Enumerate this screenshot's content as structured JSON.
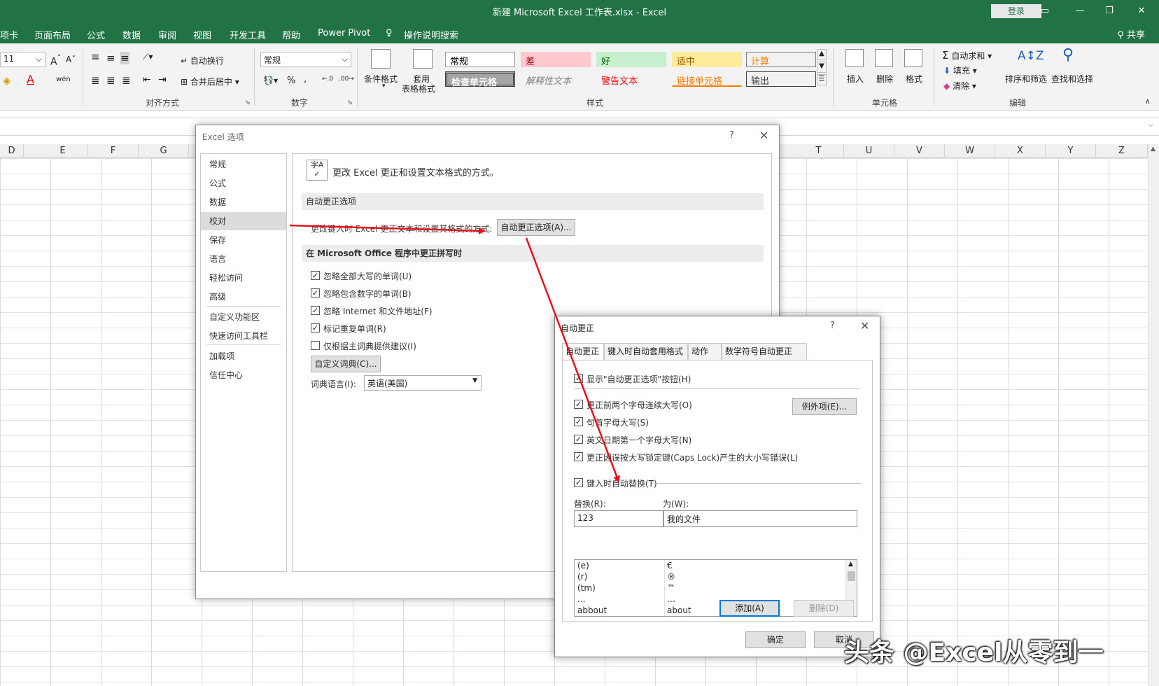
{
  "window": {
    "title": "新建 Microsoft Excel 工作表.xlsx  -  Excel",
    "login": "登录"
  },
  "menu": {
    "tabs": [
      "项卡",
      "页面布局",
      "公式",
      "数据",
      "审阅",
      "视图",
      "开发工具",
      "帮助",
      "Power Pivot",
      "操作说明搜索"
    ],
    "share": "共享"
  },
  "ribbon": {
    "font_size": "11",
    "wrap_text": "自动换行",
    "merge_center": "合并后居中",
    "align_group": "对齐方式",
    "number_format": "常规",
    "number_group": "数字",
    "cond_format": "条件格式",
    "table_format_1": "套用",
    "table_format_2": "表格格式",
    "styles": [
      {
        "label": "常规",
        "bg": "#ffffff",
        "color": "#000000",
        "border": "#9a9a9a"
      },
      {
        "label": "差",
        "bg": "#ffc7ce",
        "color": "#9c0006",
        "border": "#ffc7ce"
      },
      {
        "label": "好",
        "bg": "#c6efce",
        "color": "#006100",
        "border": "#c6efce"
      },
      {
        "label": "适中",
        "bg": "#ffeb9c",
        "color": "#9c5700",
        "border": "#ffeb9c"
      },
      {
        "label": "计算",
        "bg": "#f2f2f2",
        "color": "#fa7d00",
        "border": "#7f7f7f"
      },
      {
        "label": "检查单元格",
        "bg": "#a5a5a5",
        "color": "#ffffff",
        "border": "#3f3f3f"
      },
      {
        "label": "解释性文本",
        "bg": "#f3f3f3",
        "color": "#7f7f7f",
        "border": "#f3f3f3"
      },
      {
        "label": "警告文本",
        "bg": "#f3f3f3",
        "color": "#ff0000",
        "border": "#f3f3f3"
      },
      {
        "label": "链接单元格",
        "bg": "#f3f3f3",
        "color": "#fa7d00",
        "border": "#f3f3f3"
      },
      {
        "label": "输出",
        "bg": "#f2f2f2",
        "color": "#3f3f3f",
        "border": "#3f3f3f"
      }
    ],
    "styles_group": "样式",
    "insert": "插入",
    "delete": "删除",
    "format": "格式",
    "cells_group": "单元格",
    "autosum": "自动求和",
    "fill": "填充",
    "clear": "清除",
    "sort_filter": "排序和筛选",
    "find_select": "查找和选择",
    "edit_group": "编辑"
  },
  "grid": {
    "columns": [
      "D",
      "E",
      "F",
      "G",
      "T",
      "U",
      "V",
      "W",
      "X",
      "Y",
      "Z"
    ]
  },
  "options_dialog": {
    "title": "Excel 选项",
    "help": "?",
    "close": "✕",
    "nav": [
      "常规",
      "公式",
      "数据",
      "校对",
      "保存",
      "语言",
      "轻松访问",
      "高级",
      "自定义功能区",
      "快速访问工具栏",
      "加载项",
      "信任中心"
    ],
    "header": "更改 Excel 更正和设置文本格式的方式。",
    "section_autocorrect": "自动更正选项",
    "autocorrect_desc": "更改键入时 Excel 更正文本和设置其格式的方式:",
    "autocorrect_btn": "自动更正选项(A)...",
    "section_spelling": "在 Microsoft Office 程序中更正拼写时",
    "checks": [
      {
        "label": "忽略全部大写的单词(U)",
        "checked": true
      },
      {
        "label": "忽略包含数字的单词(B)",
        "checked": true
      },
      {
        "label": "忽略 Internet 和文件地址(F)",
        "checked": true
      },
      {
        "label": "标记重复单词(R)",
        "checked": true
      },
      {
        "label": "仅根据主词典提供建议(I)",
        "checked": false
      }
    ],
    "custom_dict_btn": "自定义词典(C)...",
    "dict_lang_label": "词典语言(I):",
    "dict_lang_value": "英语(美国)"
  },
  "autocorrect_dialog": {
    "title": "自动更正",
    "help": "?",
    "close": "✕",
    "tabs": [
      "自动更正",
      "键入时自动套用格式",
      "动作",
      "数学符号自动更正"
    ],
    "show_buttons": "显示\"自动更正选项\"按钮(H)",
    "checks": [
      "更正前两个字母连续大写(O)",
      "句首字母大写(S)",
      "英文日期第一个字母大写(N)",
      "更正因误按大写锁定键(Caps Lock)产生的大小写错误(L)"
    ],
    "exceptions_btn": "例外项(E)...",
    "replace_as_you_type": "键入时自动替换(T)",
    "replace_label": "替换(R):",
    "with_label": "为(W):",
    "replace_value": "123",
    "with_value": "我的文件",
    "list": [
      {
        "from": "(e)",
        "to": "€"
      },
      {
        "from": "(r)",
        "to": "®"
      },
      {
        "from": "(tm)",
        "to": "™"
      },
      {
        "from": "...",
        "to": "…"
      },
      {
        "from": "abbout",
        "to": "about"
      }
    ],
    "add_btn": "添加(A)",
    "delete_btn": "删除(D)",
    "ok_btn": "确定",
    "cancel_btn": "取消"
  },
  "watermark": "头条 @Excel从零到一",
  "colors": {
    "excel_green": "#217346",
    "arrow_red": "#e8111b",
    "focus_blue": "#0078d7"
  }
}
